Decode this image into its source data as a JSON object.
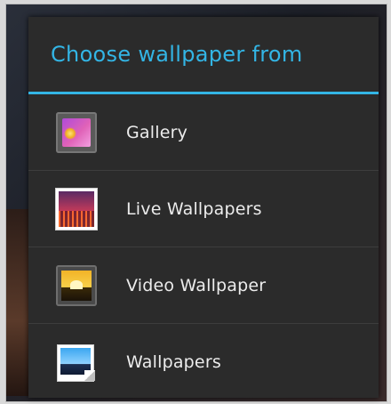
{
  "dialog": {
    "title": "Choose wallpaper from",
    "accent_color": "#33b5e5",
    "items": [
      {
        "label": "Gallery",
        "icon": "gallery-icon"
      },
      {
        "label": "Live Wallpapers",
        "icon": "live-wallpapers-icon"
      },
      {
        "label": "Video Wallpaper",
        "icon": "video-wallpaper-icon"
      },
      {
        "label": "Wallpapers",
        "icon": "wallpapers-icon"
      }
    ]
  }
}
